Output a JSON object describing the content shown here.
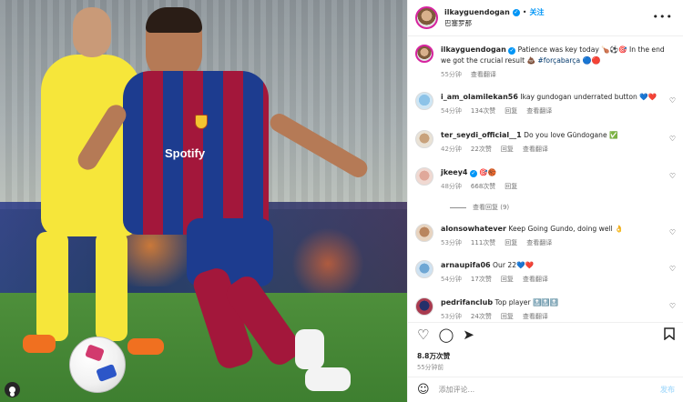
{
  "photo": {
    "sponsor_text": "Spotify",
    "viewer_icon": "user-icon"
  },
  "header": {
    "username": "ilkayguendogan",
    "follow_label": "关注",
    "location": "巴塞罗那",
    "more_icon": "more-horizontal-icon"
  },
  "caption": {
    "username": "ilkayguendogan",
    "text": "Patience was key today 🍗⚽🎯 In the end we got the crucial result 💩",
    "hashtag": "#forçabarça",
    "trailing": "🔵🔴",
    "time": "55分钟",
    "translate": "查看翻译"
  },
  "comments": [
    {
      "user": "i_am_olamilekan56",
      "text": "Ikay gundogan underrated button 💙❤️",
      "time": "54分钟",
      "likes": "134次赞",
      "reply": "回复",
      "translate": "查看翻译"
    },
    {
      "user": "ter_seydi_official__1",
      "text": "Do you love Gündogane ✅",
      "time": "42分钟",
      "likes": "22次赞",
      "reply": "回复",
      "translate": "查看翻译"
    },
    {
      "user": "jkeey4",
      "text": "🎯🏀",
      "verified": true,
      "time": "48分钟",
      "likes": "668次赞",
      "reply": "回复",
      "translate": "",
      "view_replies": "查看回复 (9)"
    },
    {
      "user": "alonsowhatever",
      "text": "Keep Going Gundo, doing well 👌",
      "time": "53分钟",
      "likes": "111次赞",
      "reply": "回复",
      "translate": "查看翻译"
    },
    {
      "user": "arnaupifa06",
      "text": "Our 22💙❤️",
      "time": "54分钟",
      "likes": "17次赞",
      "reply": "回复",
      "translate": "查看翻译"
    },
    {
      "user": "pedrifanclub",
      "text": "Top player 🔝🔝🔝",
      "time": "53分钟",
      "likes": "24次赞",
      "reply": "回复",
      "translate": "查看翻译"
    }
  ],
  "actions": {
    "like_icon": "heart-icon",
    "comment_icon": "comment-icon",
    "share_icon": "send-icon",
    "save_icon": "bookmark-icon"
  },
  "likes_count": "8.8万次赞",
  "post_time": "55分钟前",
  "comment_input": {
    "placeholder": "添加评论...",
    "post_label": "发布"
  },
  "colors": {
    "accent": "#0095f6",
    "muted": "#8e8e8e",
    "text": "#262626"
  }
}
